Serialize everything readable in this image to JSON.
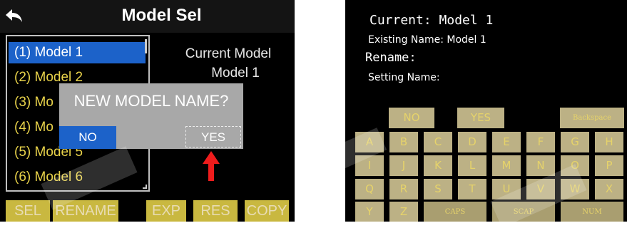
{
  "left_screen": {
    "header": {
      "title": "Model Sel",
      "back_icon": "back-arrow-icon"
    },
    "models": [
      {
        "label": "(1) Model 1",
        "selected": true
      },
      {
        "label": "(2) Model 2",
        "selected": false
      },
      {
        "label": "(3) Mo",
        "selected": false
      },
      {
        "label": "(4) Mo",
        "selected": false
      },
      {
        "label": "(5) Model 5",
        "selected": false
      },
      {
        "label": "(6) Model 6",
        "selected": false
      }
    ],
    "current_label": "Current Model",
    "current_value": "Model 1",
    "dialog": {
      "title": "NEW MODEL NAME?",
      "no": "NO",
      "yes": "YES"
    },
    "pointer_icon": "red-up-arrow-icon",
    "bottom_buttons": [
      "SEL",
      "RENAME",
      "EXP",
      "RES",
      "COPY"
    ]
  },
  "right_screen": {
    "current": "Current: Model 1",
    "existing": "Existing Name: Model 1",
    "rename": "Rename:",
    "setting": "Setting Name:",
    "keys": {
      "no": "NO",
      "yes": "YES",
      "backspace": "Backspace",
      "letters": [
        "A",
        "B",
        "C",
        "D",
        "E",
        "F",
        "G",
        "H",
        "I",
        "J",
        "K",
        "L",
        "M",
        "N",
        "O",
        "P",
        "Q",
        "R",
        "S",
        "T",
        "U",
        "V",
        "W",
        "X",
        "Y",
        "Z"
      ],
      "caps": "CAPS",
      "scap": "SCAP",
      "num": "NUM"
    }
  },
  "colors": {
    "selection": "#1c62c9",
    "list_text": "#e8d24a",
    "button_bg": "#c9b840",
    "key_bg": "#bcb185",
    "pointer": "#ee1c1c"
  }
}
